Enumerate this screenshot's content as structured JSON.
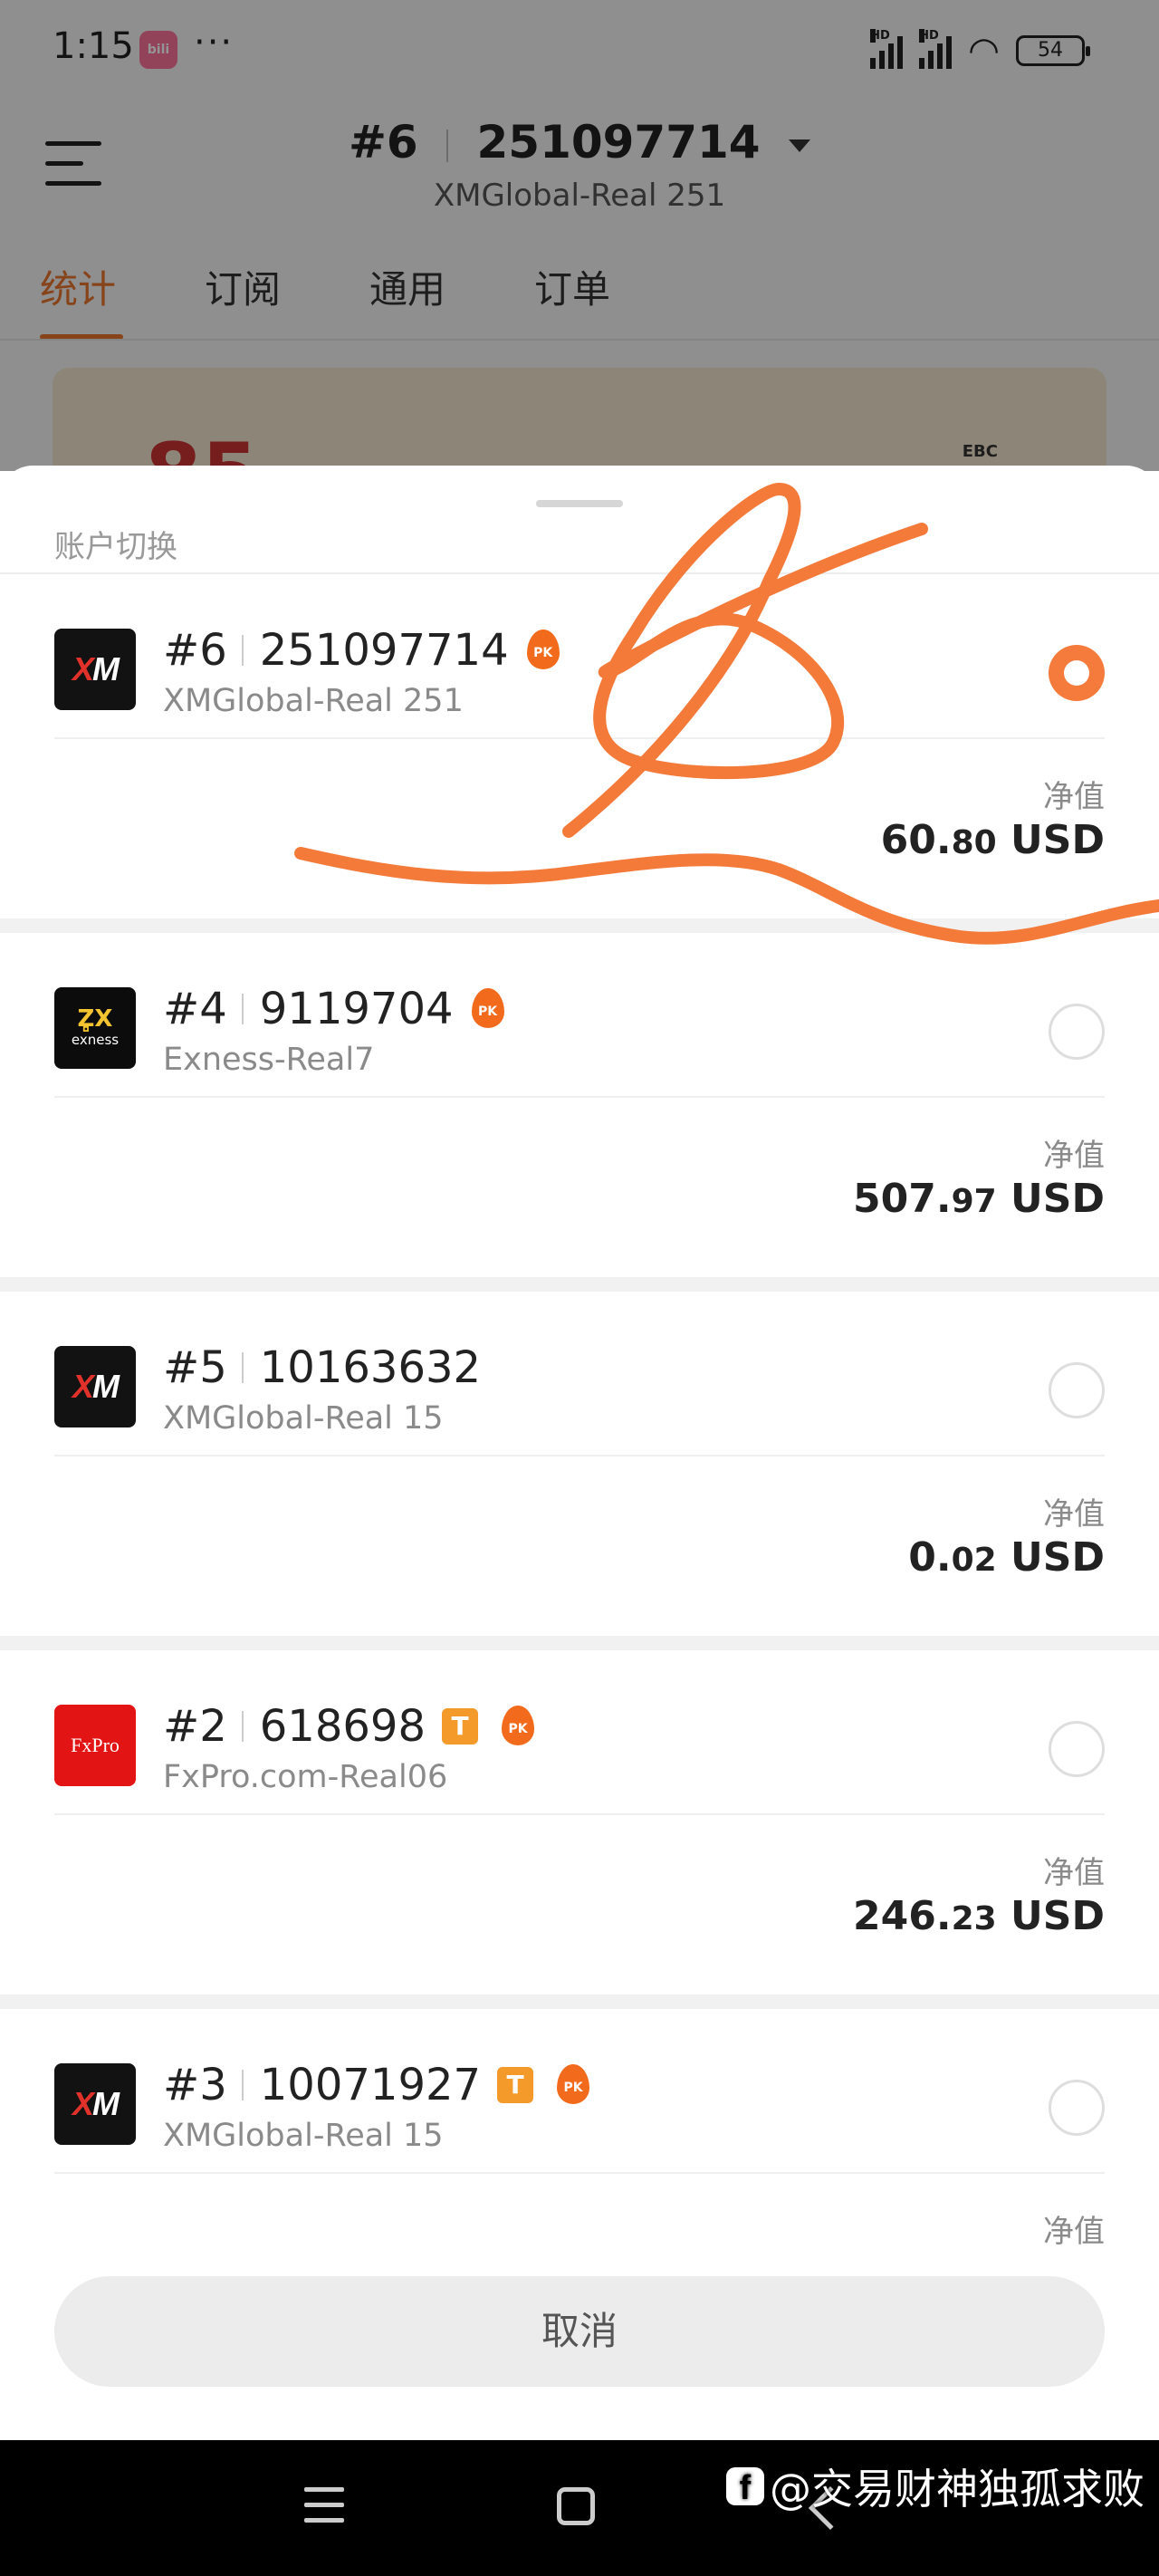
{
  "status_bar": {
    "time": "1:15",
    "app_icon_text": "bili",
    "more": "···",
    "network_label_1": "HD",
    "network_label_2": "HD",
    "battery": "54"
  },
  "header": {
    "account_num": "#6",
    "account_id": "251097714",
    "server": "XMGlobal-Real 251"
  },
  "tabs": [
    {
      "label": "统计",
      "active": true
    },
    {
      "label": "订阅",
      "active": false
    },
    {
      "label": "通用",
      "active": false
    },
    {
      "label": "订单",
      "active": false
    }
  ],
  "banner": {
    "text": "85",
    "brand": "EBC"
  },
  "sheet": {
    "title": "账户切换",
    "cancel_label": "取消",
    "accounts": [
      {
        "num": "#6",
        "id": "251097714",
        "server": "XMGlobal-Real 251",
        "logo": "XM",
        "equity_label": "净值",
        "equity_int": "60.",
        "equity_dec": "80",
        "currency": "USD",
        "selected": true
      },
      {
        "num": "#4",
        "id": "9119704",
        "server": "Exness-Real7",
        "logo": "exness",
        "equity_label": "净值",
        "equity_int": "507.",
        "equity_dec": "97",
        "currency": "USD",
        "selected": false
      },
      {
        "num": "#5",
        "id": "10163632",
        "server": "XMGlobal-Real 15",
        "logo": "XM",
        "equity_label": "净值",
        "equity_int": "0.",
        "equity_dec": "02",
        "currency": "USD",
        "selected": false
      },
      {
        "num": "#2",
        "id": "618698",
        "server": "FxPro.com-Real06",
        "logo": "FxPro",
        "badge": "T",
        "equity_label": "净值",
        "equity_int": "246.",
        "equity_dec": "23",
        "currency": "USD",
        "selected": false
      },
      {
        "num": "#3",
        "id": "10071927",
        "server": "XMGlobal-Real 15",
        "logo": "XM",
        "badge": "T",
        "equity_label": "净值",
        "selected": false
      }
    ]
  },
  "badges": {
    "pk": "PK",
    "xm_logo_a": "X",
    "xm_logo_b": "M",
    "exness_mark": "Z̻X",
    "exness_text": "exness",
    "fxpro_text": "FxPro"
  },
  "watermark": {
    "text": "@交易财神独孤求败",
    "fb_letter": "f"
  },
  "colors": {
    "accent": "#e8752f",
    "radio_selected": "#f47b3c",
    "scribble": "#f47a3a"
  }
}
